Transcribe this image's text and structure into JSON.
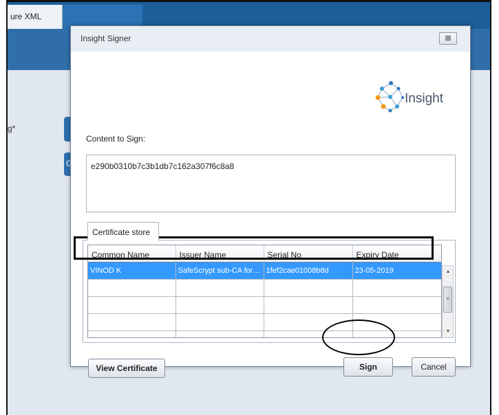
{
  "background_app": {
    "tab_label": "ure XML",
    "field_label": "g*",
    "partial_button_text": "G"
  },
  "dialog": {
    "title": "Insight Signer",
    "close_glyph": "⊠",
    "logo_text": "Insight",
    "content_label": "Content to Sign:",
    "content_value": "e290b0310b7c3b1db7c162a307f6c8a8",
    "cert_tab_label": "Certificate store",
    "table": {
      "headers": [
        "Common Name",
        "Issuer Name",
        "Serial No",
        "Expiry Date"
      ],
      "rows": [
        [
          "VINOD K",
          "SafeScrypt sub-CA for R...",
          "1fef2cae01008b8d",
          "23-05-2019"
        ],
        [
          "",
          "",
          "",
          ""
        ],
        [
          "",
          "",
          "",
          ""
        ],
        [
          "",
          "",
          "",
          ""
        ],
        [
          "",
          "",
          "",
          ""
        ]
      ]
    },
    "buttons": {
      "view_certificate": "View Certificate",
      "sign": "Sign",
      "cancel": "Cancel"
    },
    "colors": {
      "selection": "#3399ff",
      "header_blue": "#1b5e99"
    }
  }
}
